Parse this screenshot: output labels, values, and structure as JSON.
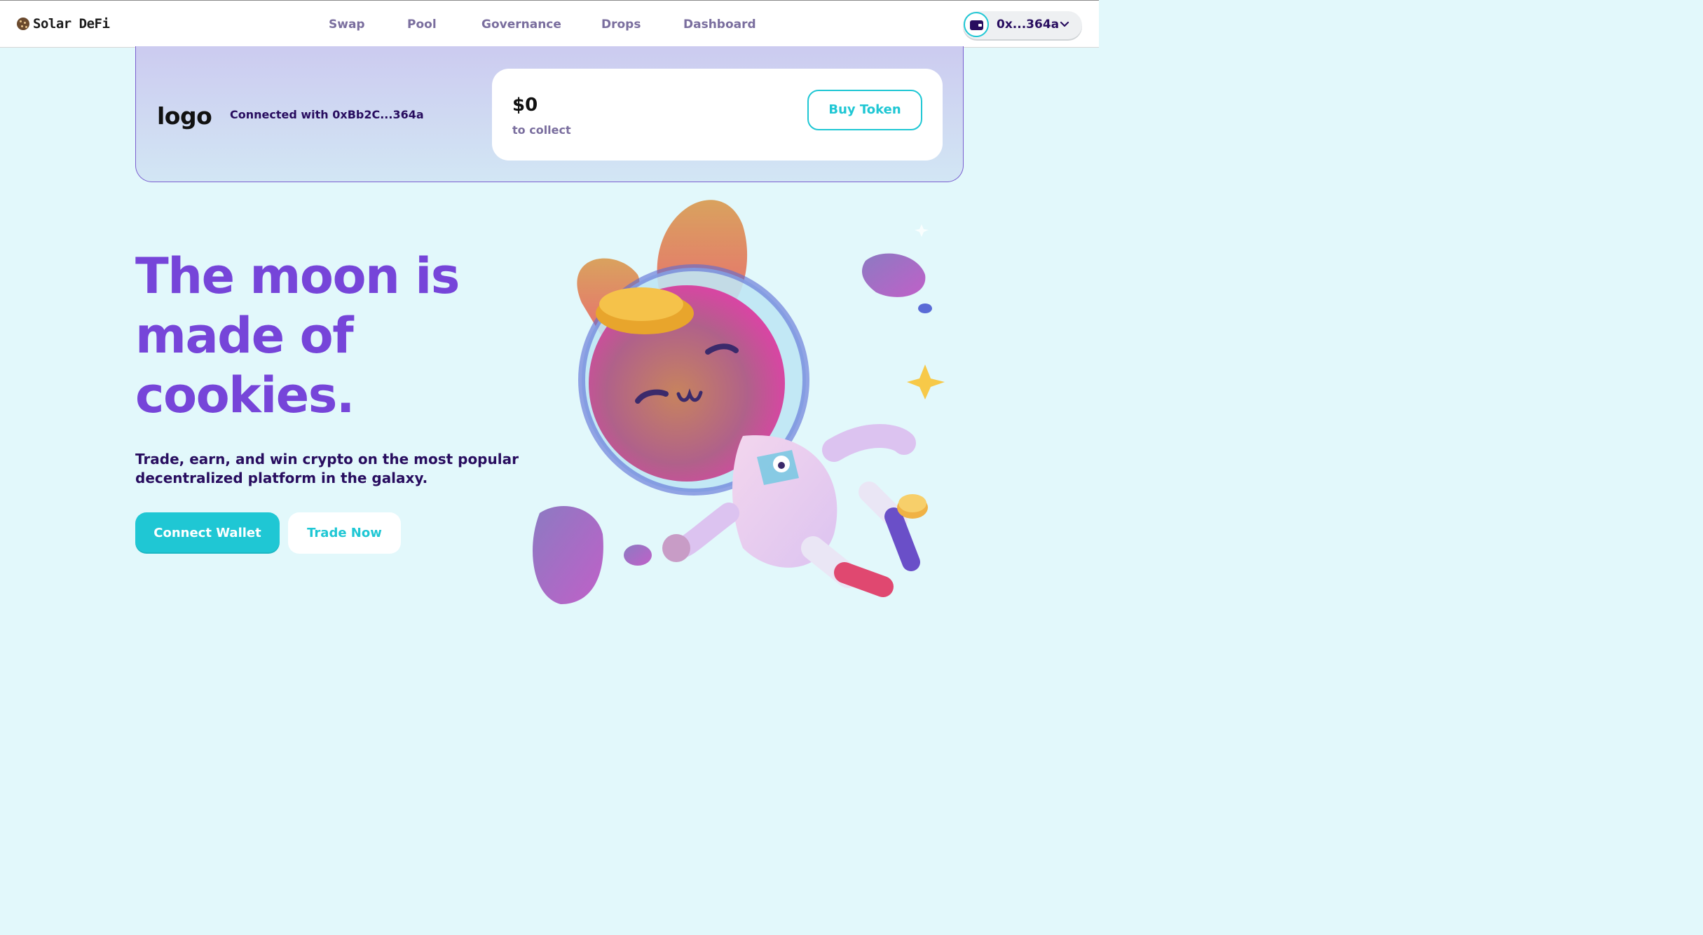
{
  "header": {
    "brand": "Solar DeFi",
    "nav": [
      "Swap",
      "Pool",
      "Governance",
      "Drops",
      "Dashboard"
    ],
    "wallet_address": "0x...364a"
  },
  "banner": {
    "logo_text": "logo",
    "connected_text": "Connected with 0xBb2C...364a",
    "collect_amount": "$0",
    "collect_label": "to collect",
    "buy_label": "Buy Token"
  },
  "hero": {
    "title_lines": [
      "The moon is",
      "made of",
      "cookies."
    ],
    "subtitle": "Trade, earn, and win crypto on the most popular decentralized platform in the galaxy.",
    "connect_label": "Connect Wallet",
    "trade_label": "Trade Now"
  },
  "icons": {
    "brand": "cookie-icon",
    "wallet": "wallet-icon",
    "dropdown": "chevron-down-icon",
    "illustration": "astronaut-bunny-illustration"
  },
  "colors": {
    "primary": "#1fc7d4",
    "secondary": "#7645d9",
    "text_dark": "#280d5f",
    "text_muted": "#7a6e9e",
    "background": "#e2f8fb"
  }
}
